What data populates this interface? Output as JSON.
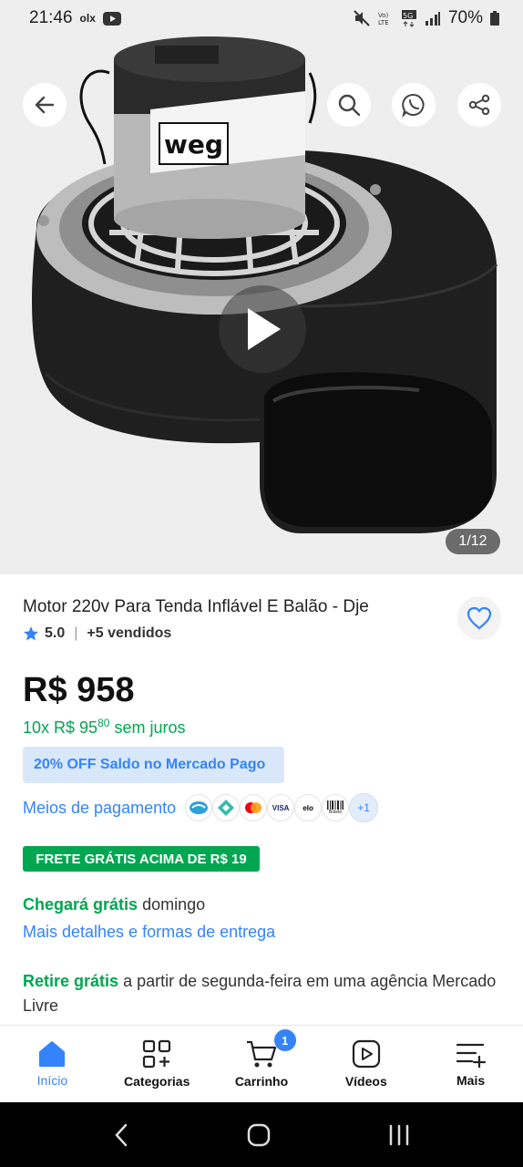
{
  "status_bar": {
    "time": "21:46",
    "app_indicator": "olx",
    "battery": "70%"
  },
  "hero": {
    "image_counter": "1/12",
    "icons": [
      "back-arrow-icon",
      "search-icon",
      "whatsapp-icon",
      "share-icon",
      "play-icon"
    ]
  },
  "product": {
    "title": "Motor 220v Para Tenda Inflável E Balão - Dje",
    "rating": "5.0",
    "sold": "+5 vendidos",
    "price": "R$ 958",
    "installments_prefix": "10x R$ 95",
    "installments_cents": "80",
    "installments_suffix": "sem juros",
    "promo": "20% OFF Saldo no Mercado Pago",
    "payment_label": "Meios de pagamento",
    "payment_more": "+1",
    "payment_methods": {
      "visa": "VISA",
      "elo": "elo",
      "boleto": "Boleto"
    },
    "free_shipping_badge": "FRETE GRÁTIS ACIMA DE R$ 19",
    "arrival_highlight": "Chegará grátis",
    "arrival_day": "domingo",
    "more_details": "Mais detalhes e formas de entrega",
    "pickup_highlight": "Retire grátis",
    "pickup_text": "a partir de segunda-feira em uma agência Mercado Livre"
  },
  "bottom_nav": {
    "items": [
      {
        "label": "Início"
      },
      {
        "label": "Categorias"
      },
      {
        "label": "Carrinho"
      },
      {
        "label": "Vídeos"
      },
      {
        "label": "Mais"
      }
    ],
    "cart_badge": "1"
  },
  "colors": {
    "accent": "#3483fa",
    "green": "#00a650"
  }
}
